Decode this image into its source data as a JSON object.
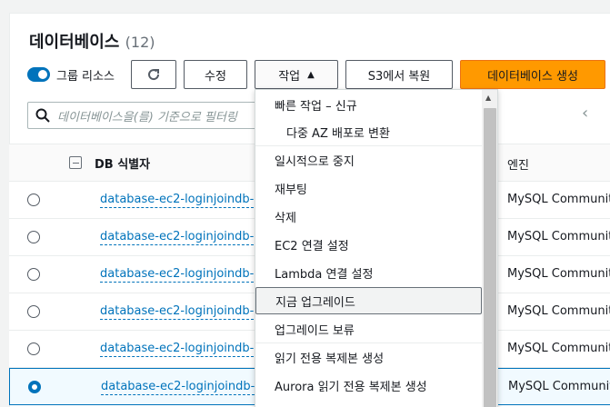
{
  "header": {
    "title": "데이터베이스",
    "count": "(12)"
  },
  "toolbar": {
    "group_toggle_label": "그룹 리소스",
    "modify_label": "수정",
    "actions_label": "작업",
    "restore_label": "S3에서 복원",
    "create_label": "데이터베이스 생성"
  },
  "search": {
    "placeholder": "데이터베이스을(를) 기준으로 필터링"
  },
  "table": {
    "columns": {
      "db_identifier": "DB 식별자",
      "engine": "엔진"
    },
    "rows": [
      {
        "db": "database-ec2-loginjoindb-",
        "engine": "MySQL Community",
        "selected": false
      },
      {
        "db": "database-ec2-loginjoindb-",
        "engine": "MySQL Community",
        "selected": false
      },
      {
        "db": "database-ec2-loginjoindb-",
        "engine": "MySQL Community",
        "selected": false
      },
      {
        "db": "database-ec2-loginjoindb-",
        "engine": "MySQL Community",
        "selected": false
      },
      {
        "db": "database-ec2-loginjoindb-",
        "engine": "MySQL Community",
        "selected": false
      },
      {
        "db": "database-ec2-loginjoindb-",
        "engine": "MySQL Community",
        "selected": true
      }
    ]
  },
  "menu": {
    "items": [
      "빠른 작업 – 신규",
      "다중 AZ 배포로 변환",
      "일시적으로 중지",
      "재부팅",
      "삭제",
      "EC2 연결 설정",
      "Lambda 연결 설정",
      "지금 업그레이드",
      "업그레이드 보류",
      "읽기 전용 복제본 생성",
      "Aurora 읽기 전용 복제본 생성"
    ]
  },
  "colors": {
    "accent": "#0073bb",
    "primary_button": "#ff9900"
  }
}
